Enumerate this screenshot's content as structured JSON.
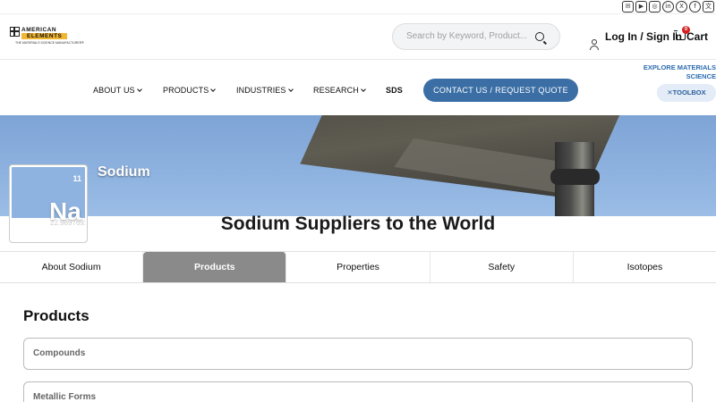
{
  "social": {
    "icons": [
      {
        "name": "email-icon",
        "glyph": "✉"
      },
      {
        "name": "youtube-icon",
        "glyph": "▶"
      },
      {
        "name": "instagram-icon",
        "glyph": "◎"
      },
      {
        "name": "linkedin-icon",
        "glyph": "in"
      },
      {
        "name": "x-icon",
        "glyph": "X"
      },
      {
        "name": "facebook-icon",
        "glyph": "f"
      },
      {
        "name": "translate-icon",
        "glyph": "文"
      }
    ]
  },
  "header": {
    "logo": {
      "line1": "AMERICAN",
      "line2": "ELEMENTS",
      "tagline": "THE MATERIALS SCIENCE MANUFACTURER®"
    },
    "search": {
      "placeholder": "Search by Keyword, Product..."
    },
    "login_label": "Log In / Sign In",
    "cart_label": "Cart",
    "cart_count": "0"
  },
  "nav": {
    "items": [
      "ABOUT US",
      "PRODUCTS",
      "INDUSTRIES",
      "RESEARCH"
    ],
    "sds": "SDS",
    "contact_label": "CONTACT US / REQUEST QUOTE",
    "explore_label": "EXPLORE MATERIALS SCIENCE",
    "toolbox_label": "TOOLBOX"
  },
  "hero": {
    "title": "Sodium",
    "element": {
      "number": "11",
      "symbol": "Na",
      "mass": "22.98976928"
    }
  },
  "page_title": "Sodium Suppliers to the World",
  "tabs": [
    {
      "label": "About Sodium",
      "active": false
    },
    {
      "label": "Products",
      "active": true
    },
    {
      "label": "Properties",
      "active": false
    },
    {
      "label": "Safety",
      "active": false
    },
    {
      "label": "Isotopes",
      "active": false
    }
  ],
  "content": {
    "section_title": "Products",
    "accordions": [
      "Compounds",
      "Metallic Forms"
    ]
  },
  "colors": {
    "accent": "#3a6ea5",
    "active_tab": "#8a8a8a",
    "hero_sky": "#8fb3e0",
    "logo_gold": "#f2b632"
  }
}
